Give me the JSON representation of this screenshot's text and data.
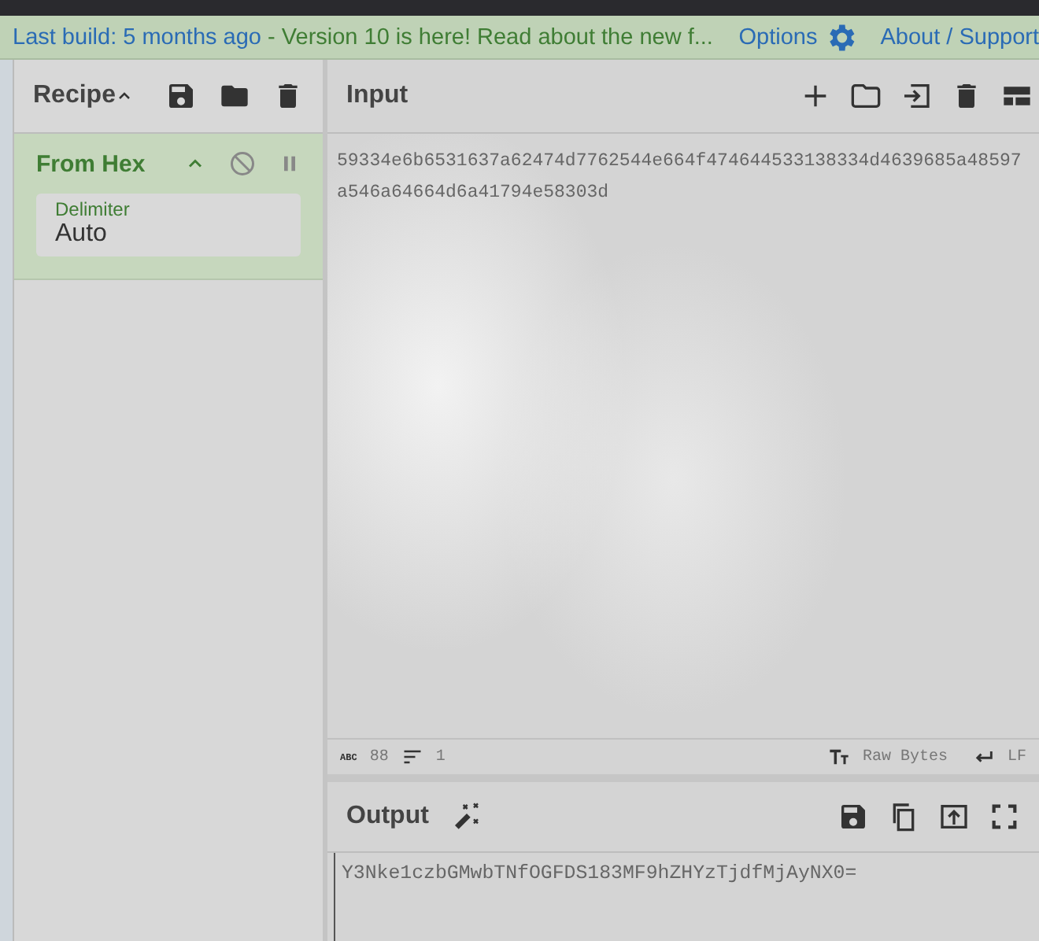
{
  "banner": {
    "build": "Last build: 5 months ago",
    "notice": " - Version 10 is here! Read about the new f...",
    "options": "Options",
    "about": "About / Support"
  },
  "recipe": {
    "title": "Recipe",
    "operations": [
      {
        "name": "From Hex",
        "expanded": true,
        "disabled": false,
        "paused": false,
        "args": [
          {
            "label": "Delimiter",
            "value": "Auto"
          }
        ]
      }
    ]
  },
  "input": {
    "title": "Input",
    "text": "59334e6b6531637a62474d7762544e664f474644533138334d4639685a48597a546a64664d6a41794e58303d",
    "status": {
      "abc_icon": "ABC",
      "length": "88",
      "lines": "1",
      "encoding": "Raw Bytes",
      "eol": "LF"
    }
  },
  "output": {
    "title": "Output",
    "text": "Y3Nke1czbGMwbTNfOGFDS183MF9hZHYzTjdfMjAyNX0="
  }
}
